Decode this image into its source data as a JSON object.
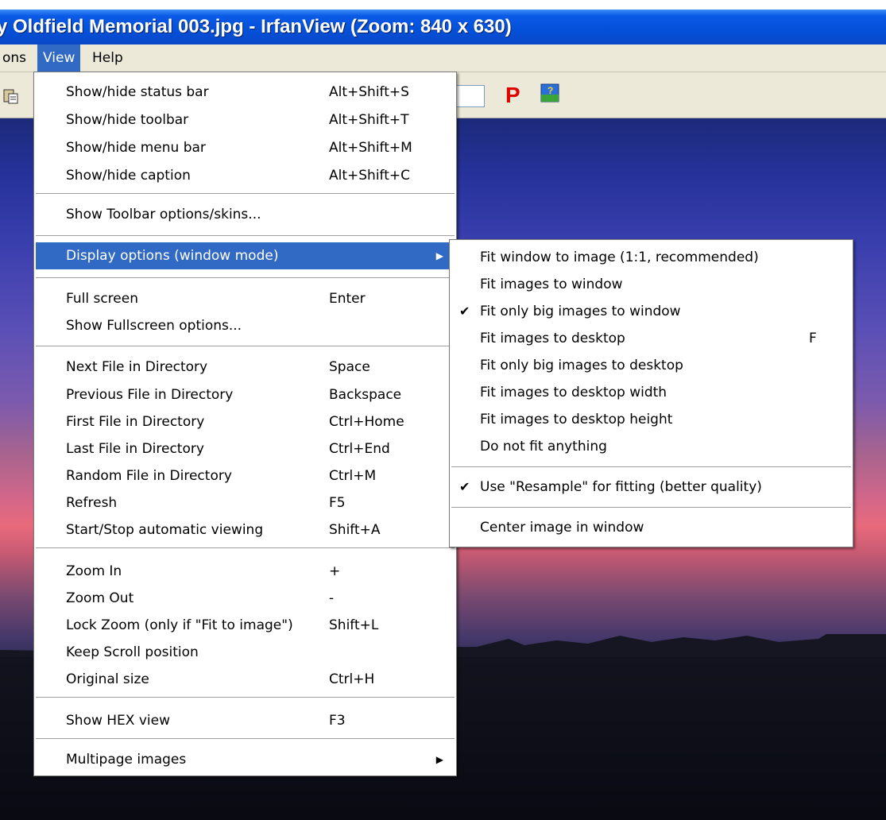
{
  "window": {
    "title": "y Oldfield Memorial 003.jpg - IrfanView (Zoom: 840 x 630)"
  },
  "menubar": {
    "items": [
      {
        "label": "ons"
      },
      {
        "label": "View"
      },
      {
        "label": "Help"
      }
    ]
  },
  "toolbar": {
    "p_label": "P"
  },
  "view_menu": {
    "items": [
      {
        "label": "Show/hide status bar",
        "shortcut": "Alt+Shift+S"
      },
      {
        "label": "Show/hide toolbar",
        "shortcut": "Alt+Shift+T"
      },
      {
        "label": "Show/hide menu bar",
        "shortcut": "Alt+Shift+M"
      },
      {
        "label": "Show/hide caption",
        "shortcut": "Alt+Shift+C"
      },
      {
        "label": "Show Toolbar options/skins...",
        "shortcut": ""
      },
      {
        "label": "Display options (window mode)",
        "shortcut": ""
      },
      {
        "label": "Full screen",
        "shortcut": "Enter"
      },
      {
        "label": "Show Fullscreen options...",
        "shortcut": ""
      },
      {
        "label": "Next File in Directory",
        "shortcut": "Space"
      },
      {
        "label": "Previous File in Directory",
        "shortcut": "Backspace"
      },
      {
        "label": "First File in Directory",
        "shortcut": "Ctrl+Home"
      },
      {
        "label": "Last File in Directory",
        "shortcut": "Ctrl+End"
      },
      {
        "label": "Random File in Directory",
        "shortcut": "Ctrl+M"
      },
      {
        "label": "Refresh",
        "shortcut": "F5"
      },
      {
        "label": "Start/Stop automatic viewing",
        "shortcut": "Shift+A"
      },
      {
        "label": "Zoom In",
        "shortcut": "+"
      },
      {
        "label": "Zoom Out",
        "shortcut": "-"
      },
      {
        "label": "Lock Zoom (only if \"Fit to image\")",
        "shortcut": "Shift+L"
      },
      {
        "label": "Keep Scroll position",
        "shortcut": ""
      },
      {
        "label": "Original size",
        "shortcut": "Ctrl+H"
      },
      {
        "label": "Show HEX view",
        "shortcut": "F3"
      },
      {
        "label": "Multipage images",
        "shortcut": ""
      }
    ]
  },
  "submenu": {
    "items": [
      {
        "label": "Fit window to image (1:1, recommended)",
        "shortcut": "",
        "checked": false
      },
      {
        "label": "Fit images to window",
        "shortcut": "",
        "checked": false
      },
      {
        "label": "Fit only big images to window",
        "shortcut": "",
        "checked": true
      },
      {
        "label": "Fit images to desktop",
        "shortcut": "F",
        "checked": false
      },
      {
        "label": "Fit only big images to desktop",
        "shortcut": "",
        "checked": false
      },
      {
        "label": "Fit images to desktop width",
        "shortcut": "",
        "checked": false
      },
      {
        "label": "Fit images to desktop height",
        "shortcut": "",
        "checked": false
      },
      {
        "label": "Do not fit anything",
        "shortcut": "",
        "checked": false
      },
      {
        "label": "Use \"Resample\" for fitting (better quality)",
        "shortcut": "",
        "checked": true
      },
      {
        "label": "Center image in window",
        "shortcut": "",
        "checked": false
      }
    ]
  },
  "glyphs": {
    "checkmark": "✔",
    "submenu_arrow": "▶"
  },
  "colors": {
    "highlight": "#316ac5",
    "titlebar": "#0450d8"
  }
}
